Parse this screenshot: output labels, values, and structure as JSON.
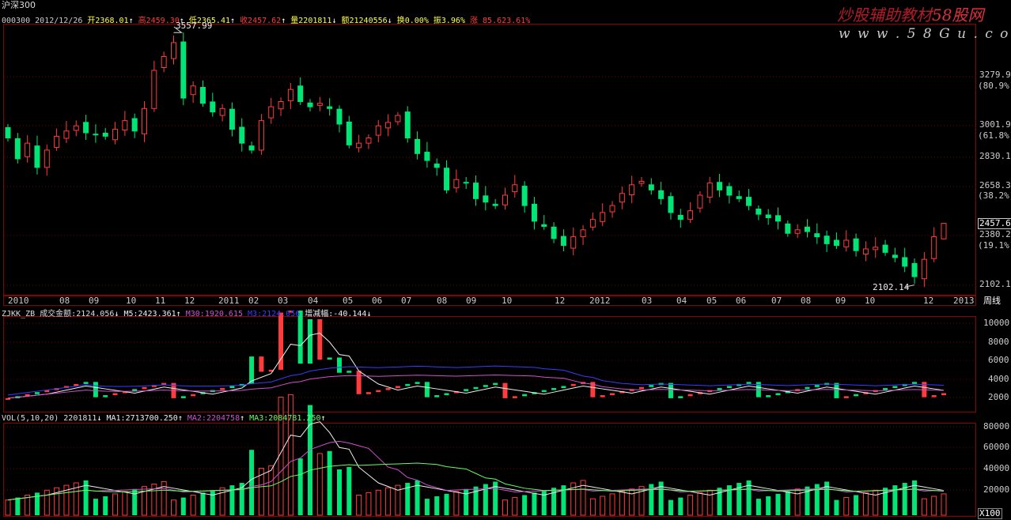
{
  "title": "沪深300",
  "info_bar": {
    "code": "000300",
    "date": "2012/12/26",
    "open": "开2368.01",
    "high": "高2459.30",
    "low": "低2365.41",
    "close": "收2457.62",
    "volume": "量2201811",
    "amount": "额21240556",
    "turnover": "换0.00%",
    "amplitude": "振3.96%",
    "change": "涨 85.62",
    "change_pct": "3.61%"
  },
  "watermark": {
    "line1": "炒股辅助教材",
    "brand": "58股网",
    "url": "w w w . 5 8 G u . c o m"
  },
  "price_axis": {
    "labels": [
      "3279.9",
      "3001.9",
      "2830.1",
      "2658.3",
      "2380.2",
      "2102.1"
    ],
    "pct_labels": [
      "(80.9%)",
      "(61.8%)",
      "(38.2%)",
      "(19.1%)"
    ],
    "current_price": "2457.6"
  },
  "annotations": {
    "peak": "3557.99",
    "trough": "2102.14"
  },
  "x_axis": {
    "labels": [
      "2010",
      "08",
      "09",
      "10",
      "11",
      "12",
      "2011",
      "02",
      "03",
      "04",
      "05",
      "06",
      "07",
      "08",
      "09",
      "10",
      "12",
      "2012",
      "03",
      "04",
      "05",
      "06",
      "07",
      "08",
      "09",
      "10",
      "12",
      "2013"
    ],
    "mode_label": "周线"
  },
  "indicator1": {
    "name": "ZJKK_ZB",
    "amount_label": "成交金额:2124.056",
    "m5": "M5:2423.361",
    "m30": "M30:1920.615",
    "m3": "M3:2124.056",
    "inc": "增减幅:-40.144",
    "axis": [
      "10000",
      "8000",
      "6000",
      "4000",
      "2000"
    ]
  },
  "indicator2": {
    "name": "VOL(5,10,20)",
    "vol": "2201811",
    "ma1": "MA1:2713700.250",
    "ma2": "MA2:2204758",
    "ma3": "MA3:2084781.250",
    "axis": [
      "80000",
      "60000",
      "40000",
      "20000"
    ],
    "unit": "X100"
  },
  "colors": {
    "up": "#ff3c3c",
    "down": "#00e676",
    "frame": "#8b0000",
    "text": "#cccccc"
  },
  "chart_data": {
    "type": "candlestick",
    "period": "weekly",
    "range": "2010 - 2012/12/26",
    "price_range": [
      2050,
      3600
    ],
    "high_point": 3557.99,
    "low_point": 2102.14,
    "last": {
      "open": 2368.01,
      "high": 2459.3,
      "low": 2365.41,
      "close": 2457.62
    },
    "closes": [
      2950,
      2830,
      2920,
      2780,
      2880,
      2960,
      2990,
      3020,
      2980,
      2970,
      2960,
      3000,
      3050,
      2990,
      3120,
      3340,
      3420,
      3500,
      3180,
      3250,
      3150,
      3100,
      3120,
      3000,
      2920,
      2880,
      3050,
      3130,
      3160,
      3230,
      3160,
      3130,
      3150,
      3120,
      3030,
      2910,
      2920,
      2950,
      3020,
      3040,
      3080,
      2950,
      2860,
      2820,
      2780,
      2650,
      2710,
      2690,
      2600,
      2580,
      2560,
      2620,
      2680,
      2560,
      2470,
      2440,
      2370,
      2330,
      2380,
      2420,
      2480,
      2520,
      2560,
      2630,
      2680,
      2700,
      2650,
      2600,
      2520,
      2480,
      2530,
      2620,
      2690,
      2650,
      2620,
      2600,
      2560,
      2510,
      2490,
      2470,
      2400,
      2420,
      2410,
      2380,
      2340,
      2330,
      2360,
      2300,
      2310,
      2320,
      2290,
      2260,
      2210,
      2150,
      2250,
      2380,
      2457.62
    ],
    "amount_series": [
      {
        "name": "M5",
        "value": 2423.361
      },
      {
        "name": "M30",
        "value": 1920.615
      },
      {
        "name": "M3",
        "value": 2124.056
      }
    ],
    "volume_ma": [
      {
        "name": "MA1",
        "value": 2713700.25
      },
      {
        "name": "MA2",
        "value": 2204758
      },
      {
        "name": "MA3",
        "value": 2084781.25
      }
    ]
  }
}
